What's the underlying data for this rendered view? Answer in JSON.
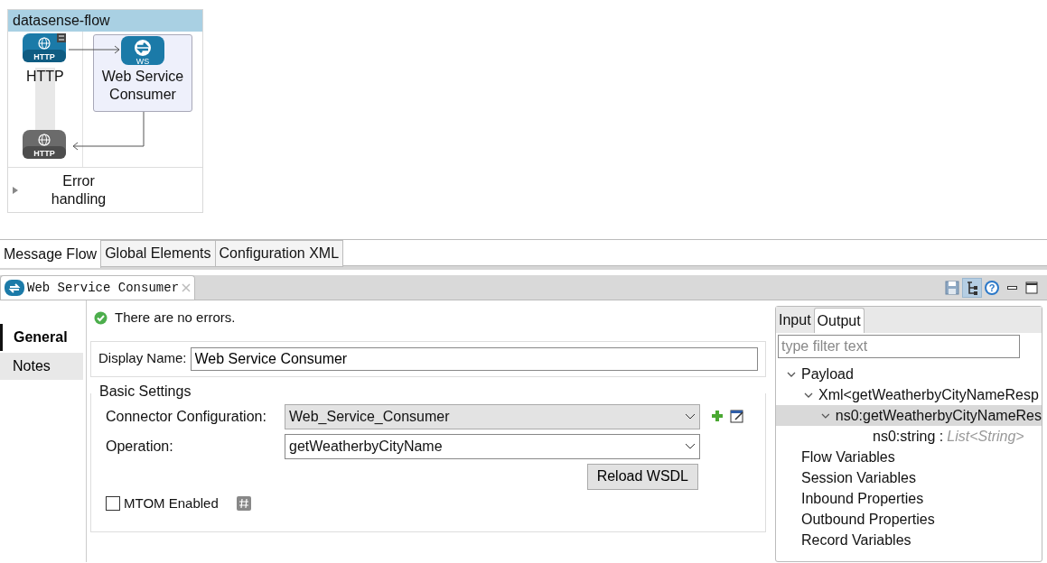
{
  "flow": {
    "title": "datasense-flow",
    "nodes": [
      {
        "kind": "http",
        "label": "HTTP",
        "icon_text": "HTTP",
        "selected": false
      },
      {
        "kind": "ws",
        "label": "Web Service Consumer",
        "icon_text": "WS",
        "selected": true
      },
      {
        "kind": "http-response",
        "icon_text": "HTTP",
        "selected": false
      }
    ],
    "error_handling": {
      "label": "Error handling",
      "expanded": false
    }
  },
  "editor_tabs": [
    {
      "label": "Message Flow",
      "selected": true
    },
    {
      "label": "Global Elements",
      "selected": false
    },
    {
      "label": "Configuration XML",
      "selected": false
    }
  ],
  "view_tab": {
    "title": "Web Service Consumer"
  },
  "view_tools": [
    {
      "kind": "save",
      "selected": false
    },
    {
      "kind": "tree",
      "selected": true
    },
    {
      "kind": "help",
      "glyph": "?",
      "selected": false
    },
    {
      "kind": "minimize",
      "selected": false
    },
    {
      "kind": "maximize",
      "selected": false
    }
  ],
  "side_tabs": [
    {
      "label": "General",
      "selected": true
    },
    {
      "label": "Notes",
      "selected": false
    }
  ],
  "status": "There are no errors.",
  "display_name": {
    "label": "Display Name:",
    "value": "Web Service Consumer"
  },
  "basic_settings": {
    "title": "Basic Settings",
    "fields": [
      {
        "label": "Connector Configuration:",
        "value": "Web_Service_Consumer",
        "disabled": true,
        "kind": "combo-with-actions"
      },
      {
        "label": "Operation:",
        "value": "getWeatherbyCityName",
        "disabled": false,
        "kind": "combo"
      }
    ],
    "reload_button": "Reload WSDL",
    "mtom": {
      "label": "MTOM Enabled",
      "checked": false
    }
  },
  "metadata": {
    "tabs": [
      {
        "label": "Input",
        "selected": false
      },
      {
        "label": "Output",
        "selected": true
      }
    ],
    "filter": {
      "placeholder": "type filter text"
    },
    "tree": [
      {
        "label": "Payload",
        "expanded": true,
        "selected": false,
        "children": [
          {
            "label": "Xml<getWeatherbyCityNameResp",
            "expanded": true,
            "selected": false,
            "children": [
              {
                "label": "ns0:getWeatherbyCityNameRes",
                "expanded": true,
                "selected": true,
                "children": [
                  {
                    "label": "ns0:string :",
                    "type": "List<String>",
                    "selected": false
                  }
                ]
              }
            ]
          }
        ]
      },
      {
        "label": "Flow Variables",
        "selected": false
      },
      {
        "label": "Session Variables",
        "selected": false
      },
      {
        "label": "Inbound Properties",
        "selected": false
      },
      {
        "label": "Outbound Properties",
        "selected": false
      },
      {
        "label": "Record Variables",
        "selected": false
      }
    ]
  }
}
